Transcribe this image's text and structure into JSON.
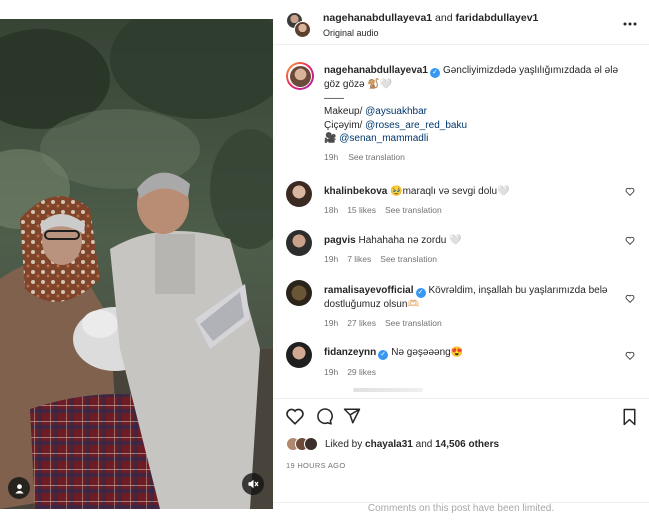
{
  "header": {
    "user1": "nagehanabdullayeva1",
    "and": " and ",
    "user2": "faridabdullayev1",
    "audio": "Original audio"
  },
  "caption": {
    "username": "nagehanabdullayeva1",
    "text_line1": "Gəncliyimizdədə yaşlılığımızdada əl ələ",
    "text_line2": "göz gözə 🐒🤍",
    "divider": "——",
    "makeup_label": "Makeup/ ",
    "makeup_mention": "@aysuakhbar",
    "flowers_label": "Çiçəyim/ ",
    "flowers_mention": "@roses_are_red_baku",
    "camera_emoji": "🎥",
    "camera_mention": "@senan_mammadli",
    "time": "19h",
    "see_translation": "See translation"
  },
  "comments": [
    {
      "username": "khalinbekova",
      "text": "🥹maraqlı və sevgi dolu🤍",
      "time": "18h",
      "likes": "15 likes",
      "see_translation": "See translation",
      "verified": false
    },
    {
      "username": "pagvis",
      "text": "Hahahaha nə zordu 🤍",
      "time": "19h",
      "likes": "7 likes",
      "see_translation": "See translation",
      "verified": false
    },
    {
      "username": "ramalisayevofficial",
      "text_line1": "Kövrəldim, inşallah bu yaşlarımızda belə",
      "text_line2": "dostluğumuz olsun🫶🏻",
      "time": "19h",
      "likes": "27 likes",
      "see_translation": "See translation",
      "verified": true
    },
    {
      "username": "fidanzeynn",
      "text": "Nə gəşəəəng😍",
      "time": "19h",
      "likes": "29 likes",
      "verified": true
    }
  ],
  "likes": {
    "prefix": "Liked by ",
    "user": "chayala31",
    "middle": " and ",
    "others": "14,506 others"
  },
  "timestamp": "19 HOURS AGO",
  "comments_limited": "Comments on this post have been limited.",
  "icons": [
    "more-icon",
    "heart-icon",
    "comment-icon",
    "share-icon",
    "save-icon",
    "user-tag-icon",
    "mute-icon",
    "verified-icon"
  ],
  "colors": {
    "link": "#00376b",
    "verified": "#3897f0",
    "muted": "#737373"
  }
}
